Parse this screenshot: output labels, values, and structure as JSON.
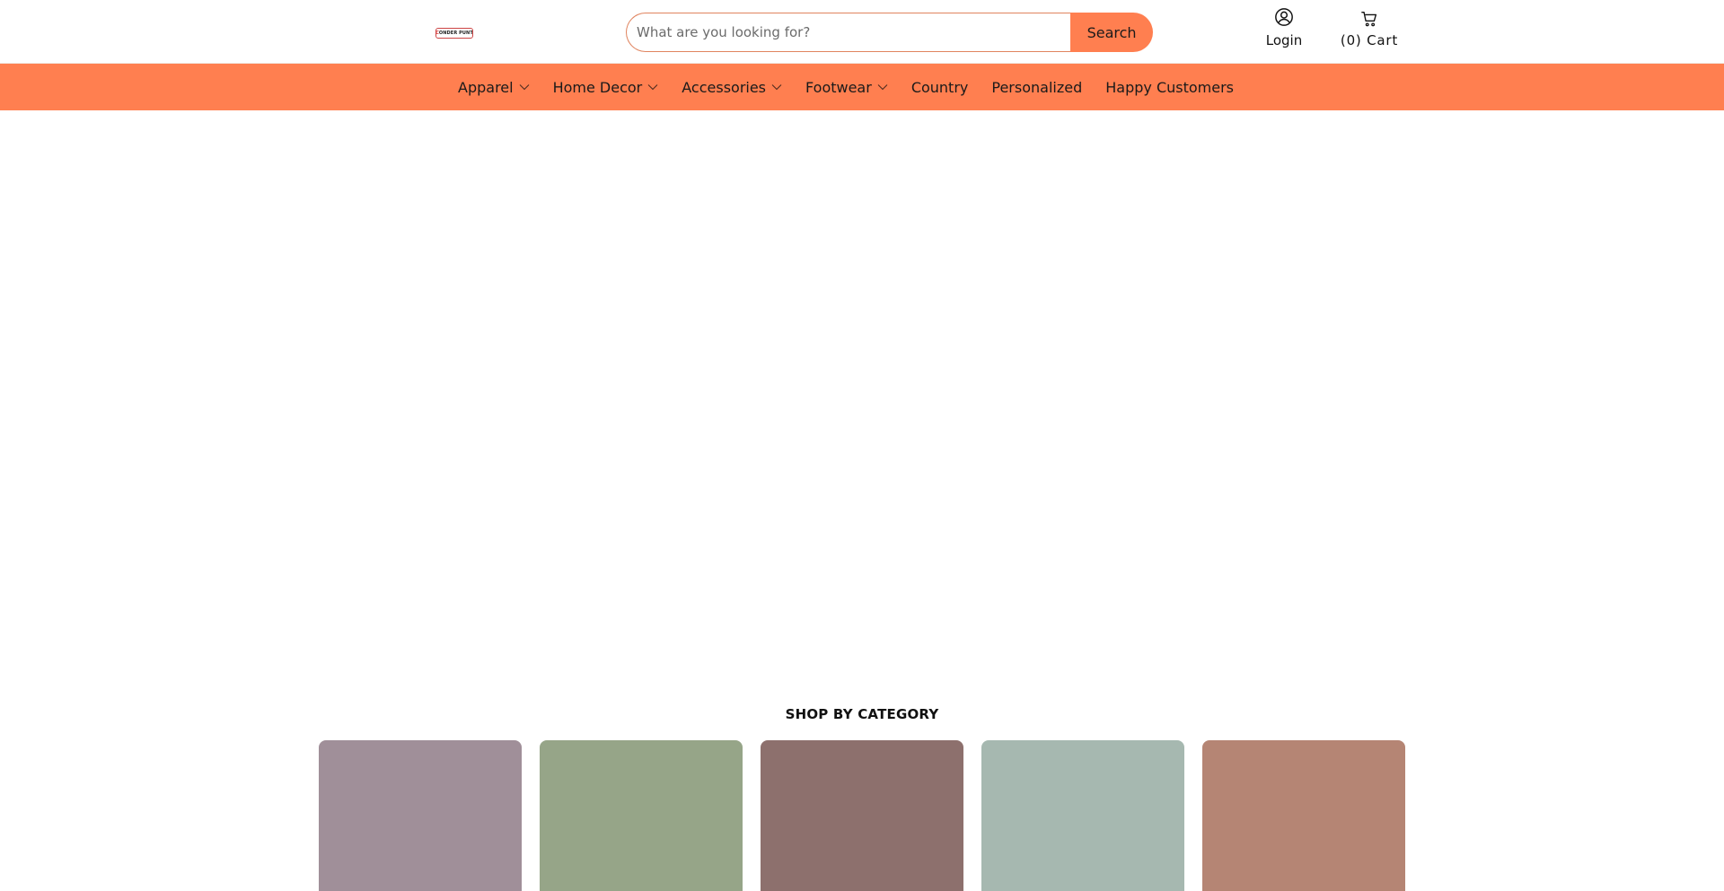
{
  "logo": {
    "text_main": "ONDER",
    "text_accent_left": "C",
    "text_right": "PUNT"
  },
  "search": {
    "placeholder": "What are you looking for?",
    "value": "",
    "button_label": "Search"
  },
  "account": {
    "login_label": "Login",
    "login_icon": "user-circle-icon"
  },
  "cart": {
    "label": "(0)  Cart",
    "icon": "cart-icon"
  },
  "nav": {
    "items": [
      {
        "label": "Apparel",
        "has_dropdown": true
      },
      {
        "label": "Home Decor",
        "has_dropdown": true
      },
      {
        "label": "Accessories",
        "has_dropdown": true
      },
      {
        "label": "Footwear",
        "has_dropdown": true
      },
      {
        "label": "Country",
        "has_dropdown": false
      },
      {
        "label": "Personalized",
        "has_dropdown": false
      },
      {
        "label": "Happy Customers",
        "has_dropdown": false
      }
    ]
  },
  "section": {
    "title": "SHOP BY CATEGORY"
  },
  "categories": [
    {
      "color": "#a08f99"
    },
    {
      "color": "#96a588"
    },
    {
      "color": "#8d706d"
    },
    {
      "color": "#a6b8b0"
    },
    {
      "color": "#b58574"
    }
  ],
  "colors": {
    "accent": "#ff7f50",
    "search_border": "#e0845f"
  }
}
